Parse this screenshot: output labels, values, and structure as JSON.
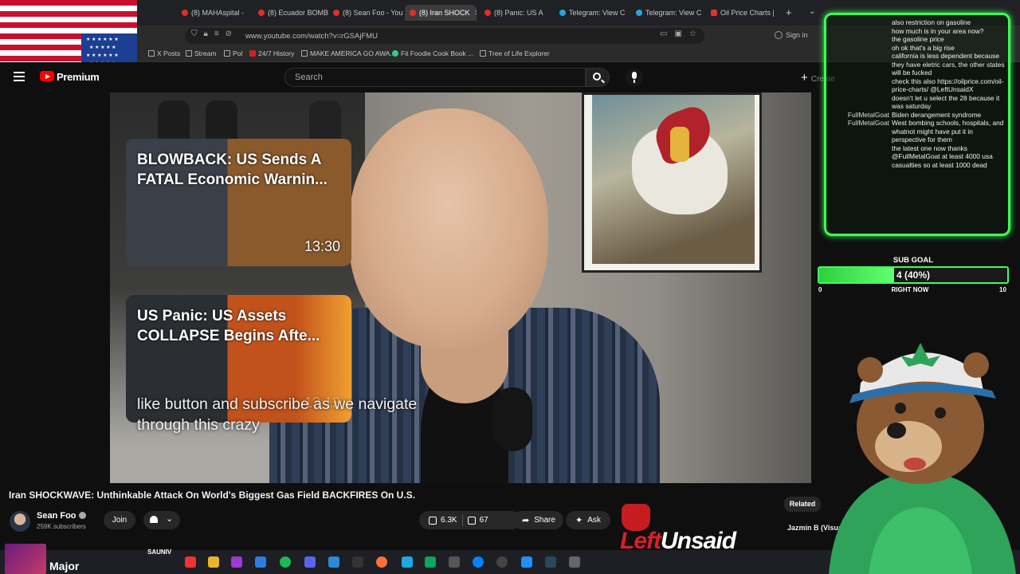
{
  "browser": {
    "tabs": [
      {
        "label": "(8) MAHAspital -",
        "favicon": "youtube-icon"
      },
      {
        "label": "(8) Ecuador BOMB",
        "favicon": "youtube-icon"
      },
      {
        "label": "(8) Sean Foo - You",
        "favicon": "youtube-icon"
      },
      {
        "label": "(8) Iran SHOCK",
        "favicon": "youtube-icon",
        "active": true
      },
      {
        "label": "(8) Panic: US A",
        "favicon": "youtube-icon"
      },
      {
        "label": "Telegram: View C",
        "favicon": "telegram-icon"
      },
      {
        "label": "Telegram: View C",
        "favicon": "telegram-icon"
      },
      {
        "label": "Oil Price Charts |",
        "favicon": "oil-icon"
      }
    ],
    "url": "www.youtube.com/watch?v=rGSAjFMU",
    "sign_in": "Sign in",
    "bookmarks": [
      {
        "label": "X Posts",
        "icon": "folder-icon"
      },
      {
        "label": "Stream",
        "icon": "folder-icon"
      },
      {
        "label": "Pol",
        "icon": "folder-icon"
      },
      {
        "label": "24/7 History",
        "icon": "history-icon"
      },
      {
        "label": "MAKE AMERICA GO AWA...",
        "icon": "page-icon"
      },
      {
        "label": "Fit Foodie Cook Book ...",
        "icon": "page-icon"
      },
      {
        "label": "Tree of Life Explorer",
        "icon": "page-icon"
      }
    ]
  },
  "youtube": {
    "logo_text": "Premium",
    "search_placeholder": "Search",
    "create_label": "Create"
  },
  "video": {
    "end_cards": [
      {
        "title": "BLOWBACK: US Sends A FATAL Economic Warnin...",
        "duration": "13:30"
      },
      {
        "title": "US Panic: US Assets COLLAPSE Begins Afte...",
        "duration": "13:12"
      }
    ],
    "caption_line1": "like button and subscribe as we navigate",
    "caption_line2": "through this crazy"
  },
  "meta": {
    "title": "Iran SHOCKWAVE: Unthinkable Attack On World's Biggest Gas Field BACKFIRES On U.S.",
    "channel_name": "Sean Foo",
    "subscribers": "259K subscribers",
    "join_label": "Join",
    "likes": "6.3K",
    "dislikes": "67",
    "share_label": "Share",
    "ask_label": "Ask",
    "related_label": "Related",
    "side_item": "Jazmin B (Visuali..."
  },
  "chat": [
    {
      "user": "",
      "msg": "also restriction on gasoline"
    },
    {
      "user": "",
      "msg": "how much is in your area now?"
    },
    {
      "user": "",
      "msg": "the gasoline price"
    },
    {
      "user": "",
      "msg": "oh ok that's a big rise"
    },
    {
      "user": "",
      "msg": "california is less dependent because they have eletric cars, the other states will be fucked"
    },
    {
      "user": "",
      "msg": "check this also https://oilprice.com/oil-price-charts/ @LeftUnsaidX"
    },
    {
      "user": "",
      "msg": "doesn't let u select the 28 because it was saturday"
    },
    {
      "user": "FullMetalGoat",
      "msg": "Biden derangement syndrome"
    },
    {
      "user": "FullMetalGoat",
      "msg": "West bombing schools, hospitals, and whatnot might have put it in perspective for them"
    },
    {
      "user": "",
      "msg": "the latest one now thanks"
    },
    {
      "user": "",
      "msg": "@FullMetalGoat at least 4000 usa casualties so at least 1000 dead"
    }
  ],
  "sub_goal": {
    "label": "SUB GOAL",
    "value_text": "4 (40%)",
    "progress": 0.4,
    "min": "0",
    "max": "10",
    "status": "RIGHT NOW"
  },
  "overlay": {
    "brand_left": "Left",
    "brand_right": "Unsaid"
  },
  "taskbar": {
    "window_title": "Major",
    "window_label": "SAUNIV"
  },
  "colors": {
    "accent_green": "#3cff56",
    "youtube_red": "#ff0000",
    "brand_red": "#d81f26"
  }
}
